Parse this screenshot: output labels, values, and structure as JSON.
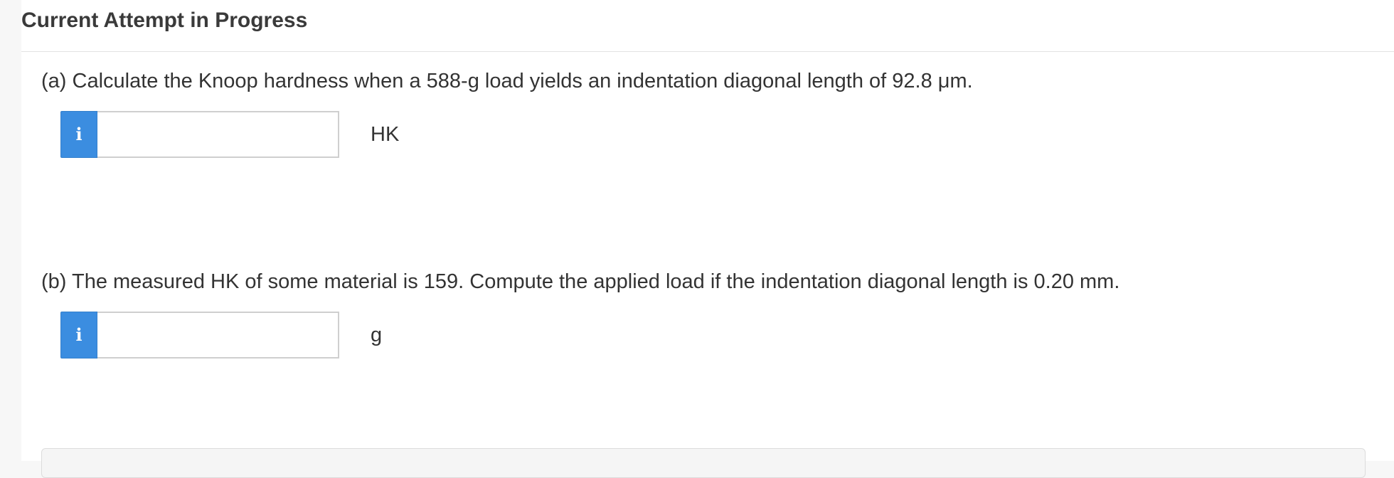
{
  "header": {
    "title": "Current Attempt in Progress"
  },
  "questions": [
    {
      "prompt": "(a) Calculate the Knoop hardness when a 588-g load yields an indentation diagonal length of 92.8 μm.",
      "info_icon": "info-icon",
      "info_glyph": "i",
      "input_value": "",
      "unit": "HK"
    },
    {
      "prompt": "(b) The measured HK of some material is 159. Compute the applied load if the indentation diagonal length is 0.20 mm.",
      "info_icon": "info-icon",
      "info_glyph": "i",
      "input_value": "",
      "unit": "g"
    }
  ],
  "colors": {
    "info_button": "#3b8de0",
    "text": "#333333",
    "title": "#3a3a3a",
    "divider": "#e3e3e3",
    "input_border": "#cfcfcf"
  }
}
